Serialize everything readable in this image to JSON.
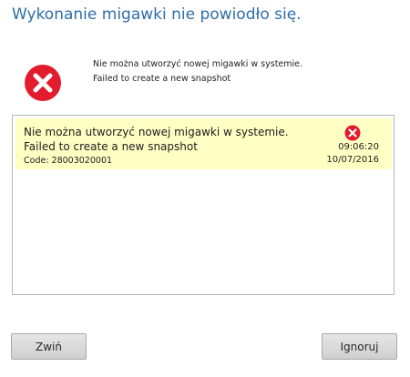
{
  "dialog": {
    "title": "Wykonanie migawki nie powiodło się."
  },
  "summary": {
    "line_pl": "Nie można utworzyć nowej migawki w systemie.",
    "line_en": "Failed to create a new snapshot"
  },
  "messages": [
    {
      "line_pl": "Nie można utworzyć nowej migawki w systemie.",
      "line_en": "Failed to create a new snapshot",
      "code": "Code: 28003020001",
      "time": "09:06:20",
      "date": "10/07/2016",
      "icon": "error-icon"
    }
  ],
  "buttons": {
    "collapse_label": "Zwiń",
    "ignore_label": "Ignoruj"
  },
  "colors": {
    "title": "#2d6ea8",
    "error": "#e21b2d",
    "row_highlight": "#ffffc4"
  }
}
